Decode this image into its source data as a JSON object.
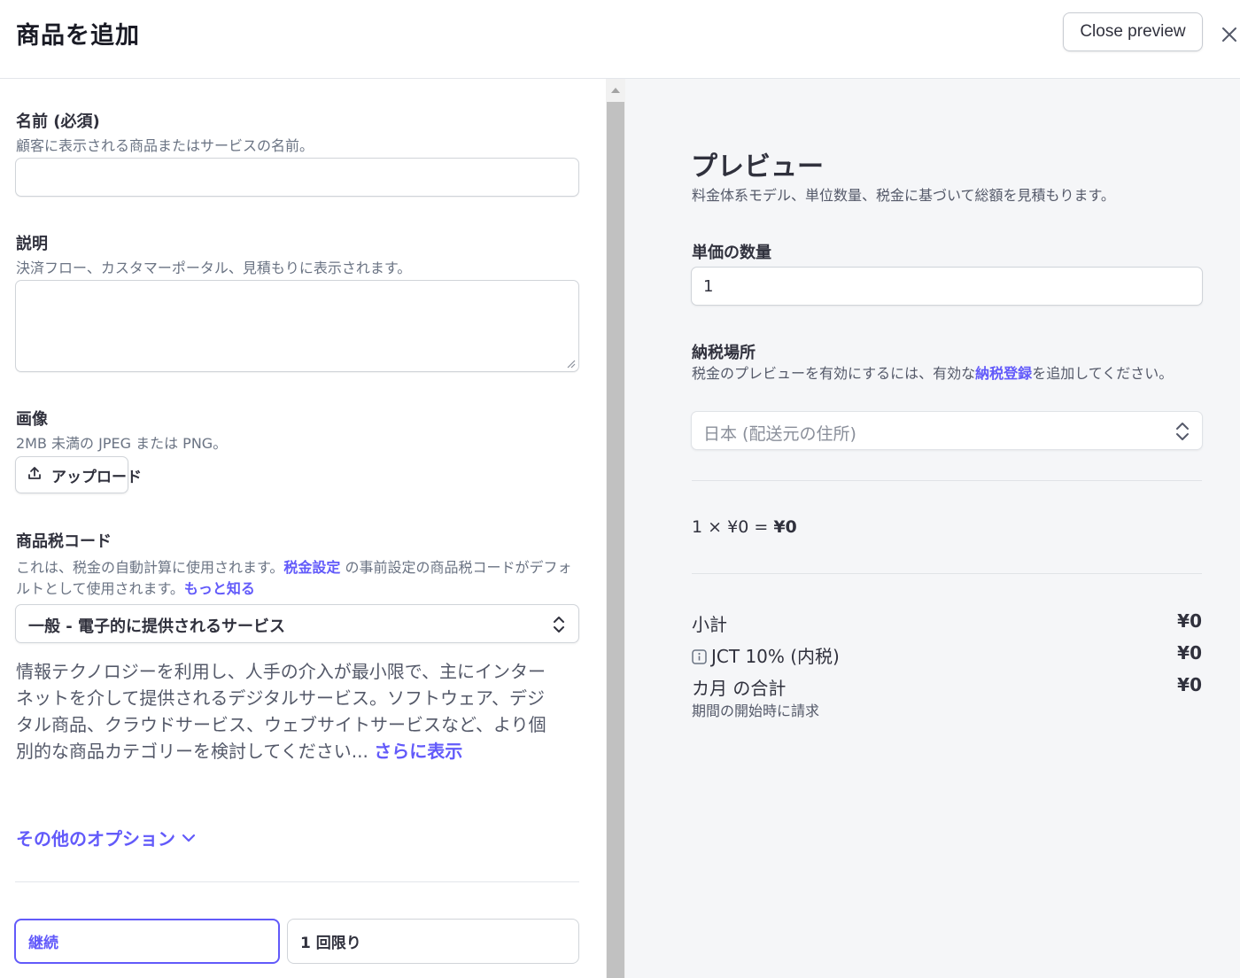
{
  "header": {
    "title": "商品を追加",
    "close_preview_label": "Close preview",
    "close_icon": "close-icon"
  },
  "form": {
    "name": {
      "label": "名前 (必須)",
      "help": "顧客に表示される商品またはサービスの名前。",
      "value": ""
    },
    "description": {
      "label": "説明",
      "help": "決済フロー、カスタマーポータル、見積もりに表示されます。",
      "value": ""
    },
    "image": {
      "label": "画像",
      "help": "2MB 未満の JPEG または PNG。",
      "upload_label": "アップロード",
      "upload_icon": "upload-icon"
    },
    "tax_code": {
      "label": "商品税コード",
      "help_part1": "これは、税金の自動計算に使用されます。",
      "help_link1": "税金設定",
      "help_part2": " の事前設定の商品税コードがデフォルトとして使用されます。",
      "help_link2": "もっと知る",
      "selected": "一般 - 電子的に提供されるサービス",
      "description": "情報テクノロジーを利用し、人手の介入が最小限で、主にインターネットを介して提供されるデジタルサービス。ソフトウェア、デジタル商品、クラウドサービス、ウェブサイトサービスなど、より個別的な商品カテゴリーを検討してください...",
      "show_more": "さらに表示"
    },
    "more_options": "その他のオプション",
    "billing_type": {
      "options": [
        "継続",
        "1 回限り"
      ],
      "selected": "継続"
    }
  },
  "preview": {
    "title": "プレビュー",
    "subtitle": "料金体系モデル、単位数量、税金に基づいて総額を見積もります。",
    "quantity_label": "単価の数量",
    "quantity_value": "1",
    "tax_location_label": "納税場所",
    "tax_help_part1": "税金のプレビューを有効にするには、有効な",
    "tax_help_link": "納税登録",
    "tax_help_part2": "を追加してください。",
    "tax_location_value": "日本 (配送元の住所)",
    "calc_qty": "1",
    "calc_times": "×",
    "calc_price": "¥0",
    "calc_equals": "=",
    "calc_total": "¥0",
    "subtotal_label": "小計",
    "subtotal_value": "¥0",
    "tax_label": "JCT 10% (内税)",
    "tax_value": "¥0",
    "monthly_total_label": "カ月 の合計",
    "monthly_total_value": "¥0",
    "billing_note": "期間の開始時に請求"
  },
  "colors": {
    "accent": "#625afa",
    "text": "#30313d",
    "muted": "#545969",
    "preview_bg": "#f5f6f8"
  }
}
